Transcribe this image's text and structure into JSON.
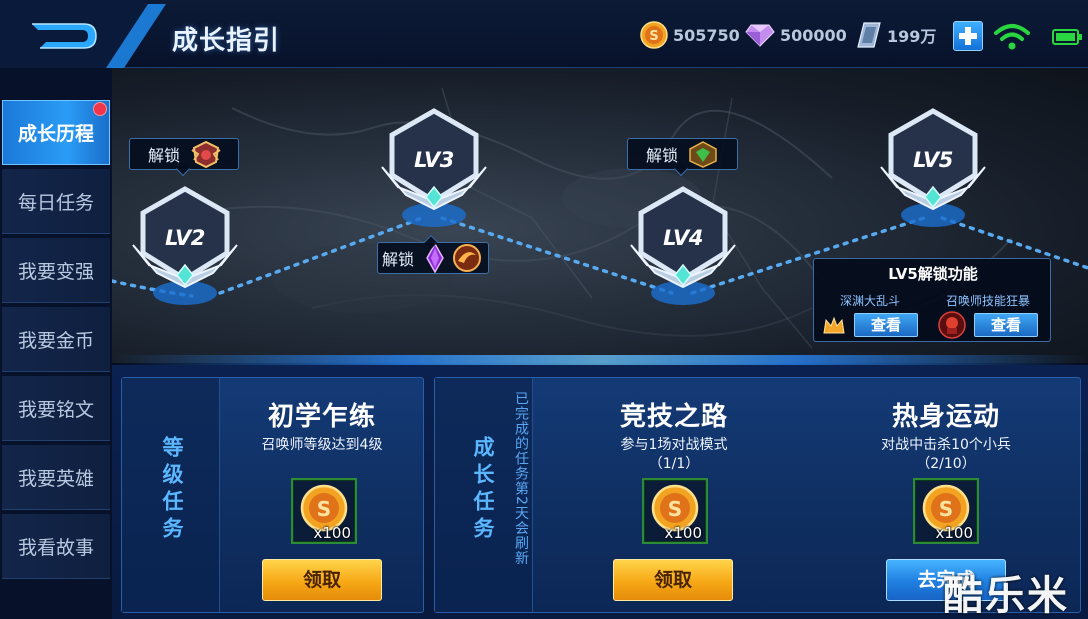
{
  "header": {
    "title": "成长指引",
    "currencies": [
      {
        "name": "gold-coin",
        "amount": "505750"
      },
      {
        "name": "diamond",
        "amount": "500000"
      },
      {
        "name": "coupon",
        "amount": "199万"
      }
    ]
  },
  "sidebar": {
    "items": [
      {
        "label": "成长历程",
        "active": true
      },
      {
        "label": "每日任务"
      },
      {
        "label": "我要变强"
      },
      {
        "label": "我要金币"
      },
      {
        "label": "我要铭文"
      },
      {
        "label": "我要英雄"
      },
      {
        "label": "我看故事"
      }
    ]
  },
  "growth_map": {
    "levels": [
      "LV2",
      "LV3",
      "LV4",
      "LV5"
    ],
    "unlock_label": "解锁",
    "lv5_panel": {
      "title": "LV5解锁功能",
      "features": [
        {
          "name": "深渊大乱斗",
          "button": "查看"
        },
        {
          "name": "召唤师技能狂暴",
          "button": "查看"
        }
      ]
    }
  },
  "level_tasks": {
    "side_label": "等级任务",
    "task": {
      "title": "初学乍练",
      "description": "召唤师等级达到4级",
      "reward_qty": "x100",
      "button": "领取"
    }
  },
  "growth_tasks": {
    "side_label": "成长任务",
    "note": "已完成的任务第2天会刷新",
    "tasks": [
      {
        "title": "竞技之路",
        "description": "参与1场对战模式",
        "progress": "（1/1）",
        "reward_qty": "x100",
        "button": "领取"
      },
      {
        "title": "热身运动",
        "description": "对战中击杀10个小兵",
        "progress": "（2/10）",
        "reward_qty": "x100",
        "button": "去完成"
      }
    ]
  },
  "watermark": "酷乐米",
  "colors": {
    "accent_blue": "#2a9cf6",
    "gold_button": "#f7a816",
    "panel_blue": "#143a76"
  }
}
